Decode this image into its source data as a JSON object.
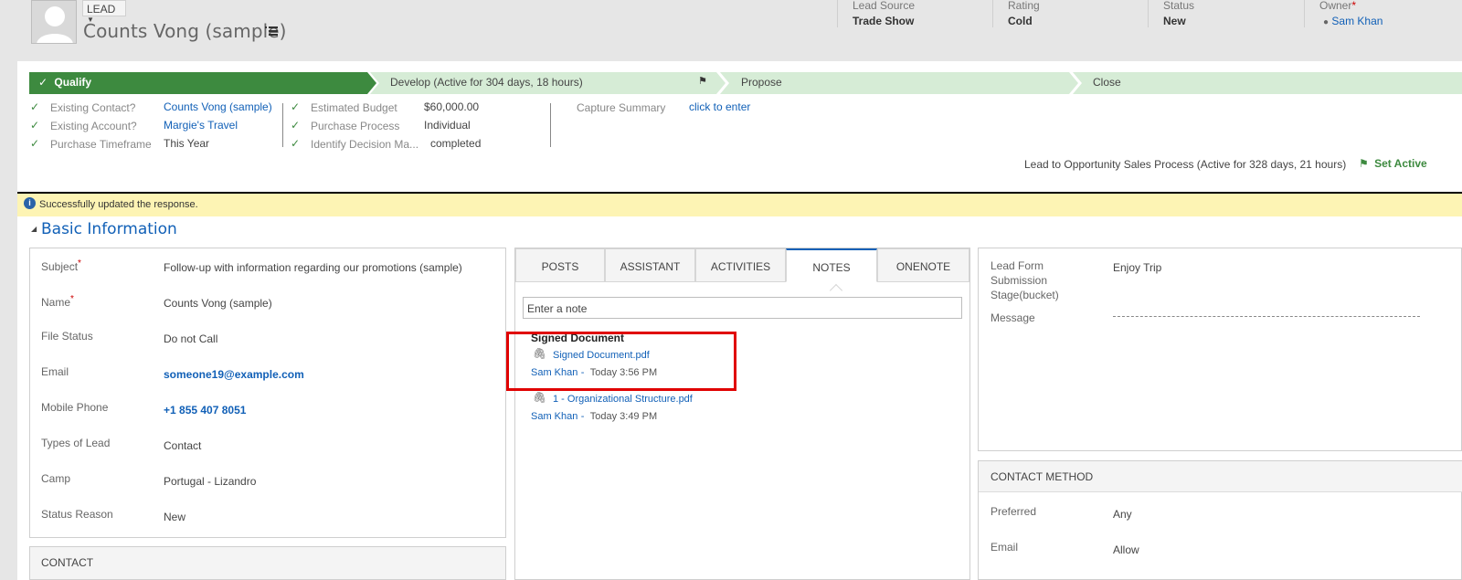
{
  "header": {
    "entity_type": "LEAD",
    "record_title": "Counts Vong (sample)",
    "fields": [
      {
        "label": "Lead Source",
        "value": "Trade Show"
      },
      {
        "label": "Rating",
        "value": "Cold"
      },
      {
        "label": "Status",
        "value": "New"
      },
      {
        "label": "Owner",
        "value": "Sam Khan",
        "required_mark": "*"
      }
    ]
  },
  "process": {
    "stages": [
      "Qualify",
      "Develop (Active for 304 days, 18 hours)",
      "Propose",
      "Close"
    ],
    "col1": [
      {
        "label": "Existing Contact?",
        "value": "Counts Vong (sample)"
      },
      {
        "label": "Existing Account?",
        "value": "Margie's Travel"
      },
      {
        "label": "Purchase Timeframe",
        "value": "This Year"
      }
    ],
    "col2": [
      {
        "label": "Estimated Budget",
        "value": "$60,000.00"
      },
      {
        "label": "Purchase Process",
        "value": "Individual"
      },
      {
        "label": "Identify Decision Ma...",
        "value": "completed"
      }
    ],
    "capture_summary": {
      "label": "Capture Summary",
      "value": "click to enter"
    },
    "process_name": "Lead to Opportunity Sales Process (Active for 328 days, 21 hours)",
    "set_active": "Set Active"
  },
  "notification": {
    "icon": "info-icon",
    "text": "Successfully updated the response."
  },
  "basic_info": {
    "title": "Basic Information",
    "fields": [
      {
        "label": "Subject",
        "required": "*",
        "value": "Follow-up with information regarding our promotions (sample)"
      },
      {
        "label": "Name",
        "required": "*",
        "value": "Counts Vong (sample)"
      },
      {
        "label": "File Status",
        "value": "Do not Call"
      },
      {
        "label": "Email",
        "value": "someone19@example.com"
      },
      {
        "label": "Mobile Phone",
        "value": "+1 855 407 8051"
      },
      {
        "label": "Types of Lead",
        "value": "Contact"
      },
      {
        "label": "Camp",
        "value": "Portugal - Lizandro"
      },
      {
        "label": "Status Reason",
        "value": "New"
      }
    ],
    "contact_section": "CONTACT"
  },
  "social": {
    "tabs": [
      "POSTS",
      "ASSISTANT",
      "ACTIVITIES",
      "NOTES",
      "ONENOTE"
    ],
    "active_tab": "NOTES",
    "note_placeholder": "Enter a note",
    "notes": [
      {
        "title": "Signed Document",
        "attachment": "Signed Document.pdf",
        "author": "Sam Khan",
        "sep": "-",
        "time": "Today 3:56 PM"
      },
      {
        "title": "",
        "attachment": "1 - Organizational Structure.pdf",
        "author": "Sam Khan",
        "sep": "-",
        "time": "Today 3:49 PM"
      }
    ]
  },
  "right_panel": {
    "fields": [
      {
        "label": "Lead Form Submission Stage(bucket)",
        "value": "Enjoy Trip"
      },
      {
        "label": "Message",
        "value": ""
      }
    ],
    "contact_method": {
      "title": "CONTACT METHOD",
      "fields": [
        {
          "label": "Preferred",
          "value": "Any"
        },
        {
          "label": "Email",
          "value": "Allow"
        }
      ]
    }
  }
}
